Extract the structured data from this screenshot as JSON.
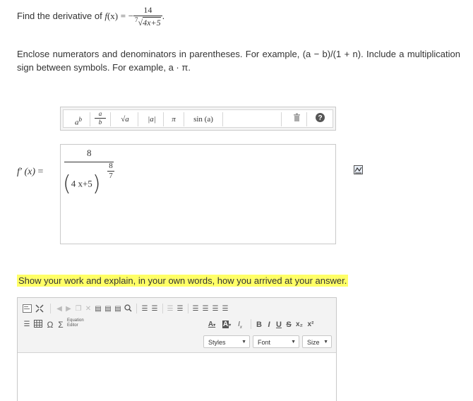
{
  "question": {
    "prefix": "Find the derivative of",
    "func_f": "f",
    "func_x": "(x)",
    "equals": "=",
    "minus": "−",
    "numerator": "14",
    "root_index": "7",
    "radicand": "4x+5",
    "period": "."
  },
  "instructions": "Enclose numerators and denominators in parentheses. For example, (a − b)/(1 + n). Include a multiplication sign between symbols. For example, a · π.",
  "math_toolbar": {
    "power": "a",
    "power_sup": "b",
    "frac_num": "a",
    "frac_den": "b",
    "sqrt": "√a",
    "abs": "|a|",
    "pi": "π",
    "sin": "sin (a)"
  },
  "answer": {
    "label_f": "f′",
    "label_x": "(x)",
    "label_eq": "=",
    "top_numerator": "8",
    "paren_expr": "4 x+5",
    "exp_num": "8",
    "exp_den": "7"
  },
  "work_prompt": "Show your work and explain, in your own words, how you arrived at your answer.",
  "editor": {
    "equation_editor_line1": "Equation",
    "equation_editor_line2": "Editor",
    "styles_label": "Styles",
    "font_label": "Font",
    "size_label": "Size",
    "bold": "B",
    "italic": "I",
    "underline": "U",
    "strike": "S",
    "sub": "x₂",
    "sup": "x²",
    "omega": "Ω",
    "sigma": "Σ"
  },
  "colors": {
    "highlight": "#ffff66",
    "toolbar_bg": "#f3f3f3",
    "border": "#c9c9c9"
  }
}
